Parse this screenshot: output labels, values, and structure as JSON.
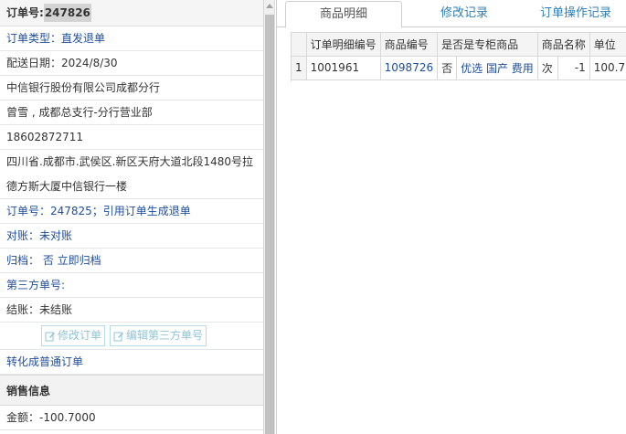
{
  "left": {
    "order_label": "订单号:",
    "order_no": "247826",
    "order_type": "订单类型：直发退单",
    "delivery_date": "配送日期：2024/8/30",
    "company": "中信银行股份有限公司成都分行",
    "contact": "曾雪 , 成都总支行-分行营业部",
    "phone": "18602872711",
    "address": "四川省.成都市.武侯区.新区天府大道北段1480号拉德方斯大厦中信银行一楼",
    "ref_order": "订单号：247825；引用订单生成退单",
    "reconcile": "对账：未对账",
    "archive": "归档： 否 立即归档",
    "third_party_no": "第三方单号:",
    "settle": "结账：未结账",
    "btn_modify": "修改订单",
    "btn_edit_third": "编辑第三方单号",
    "convert": "转化成普通订单",
    "sales_header": "销售信息",
    "amount": "金额：-100.7000"
  },
  "tabs": [
    {
      "label": "商品明细"
    },
    {
      "label": "修改记录"
    },
    {
      "label": "订单操作记录"
    }
  ],
  "table": {
    "headers": [
      "",
      "订单明细编号",
      "商品编号",
      "是否是专柜商品",
      "商品名称",
      "单位"
    ],
    "rows": [
      [
        "1",
        "1001961",
        "1098726",
        "否",
        "优选 国产 费用",
        "次",
        "-1",
        "100.7"
      ]
    ]
  },
  "colors": {
    "link": "#1f4e9a",
    "tab": "#2f7fb5",
    "button_text": "#8fc4d6"
  }
}
